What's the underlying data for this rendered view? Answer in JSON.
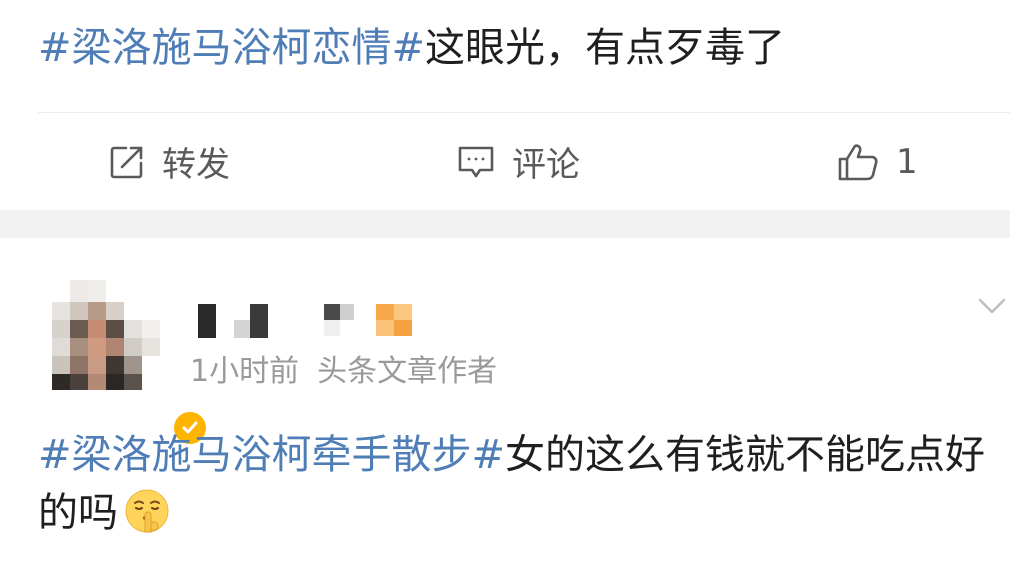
{
  "post1": {
    "topic": "#梁洛施马浴柯恋情#",
    "text": "这眼光，有点歹毒了",
    "actions": {
      "repost_label": "转发",
      "comment_label": "评论",
      "like_count": "1"
    }
  },
  "post2": {
    "author": {
      "avatar_icon": "avatar-pixelated",
      "verified_icon": "verified-badge-icon"
    },
    "meta": {
      "time": "1小时前",
      "source": "头条文章作者"
    },
    "topic": "#梁洛施马浴柯牵手散步#",
    "text": "女的这么有钱就不能吃点好的吗",
    "emoji": "shushing-face"
  },
  "colors": {
    "topic": "#4f7db6",
    "text": "#1f1f1f",
    "meta": "#9a9a9a",
    "action": "#5a5a5a",
    "separator": "#f2f2f2"
  }
}
